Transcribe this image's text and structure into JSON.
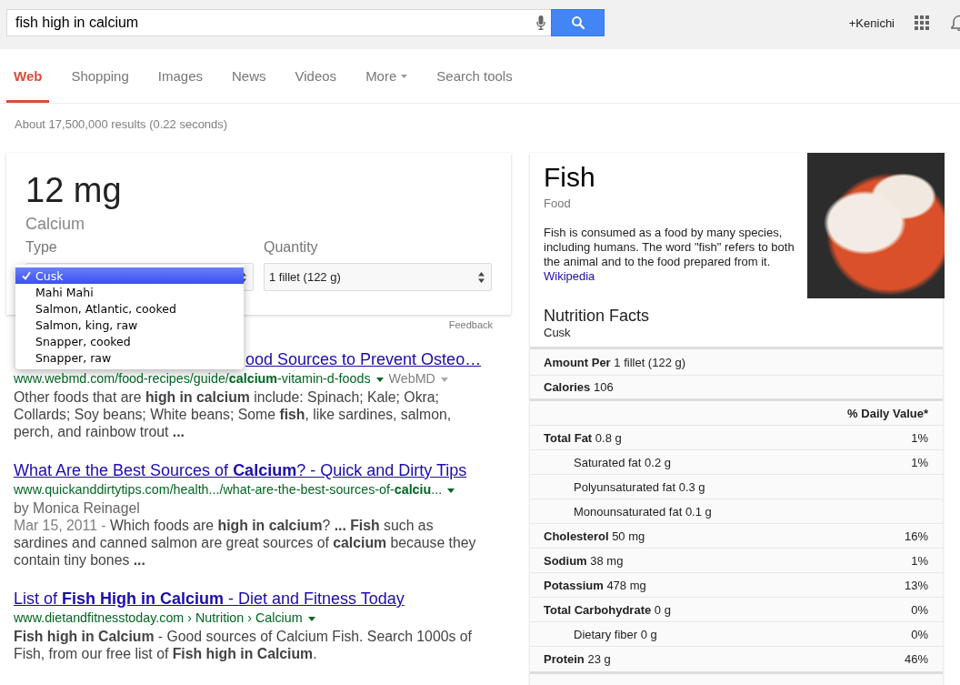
{
  "search": {
    "value": "fish high in calcium"
  },
  "account": {
    "name": "+Kenichi"
  },
  "tabs": [
    {
      "label": "Web",
      "selected": true,
      "kind": "plain"
    },
    {
      "label": "Shopping",
      "selected": false,
      "kind": "plain"
    },
    {
      "label": "Images",
      "selected": false,
      "kind": "plain"
    },
    {
      "label": "News",
      "selected": false,
      "kind": "plain"
    },
    {
      "label": "Videos",
      "selected": false,
      "kind": "plain"
    },
    {
      "label": "More",
      "selected": false,
      "kind": "dropdown"
    },
    {
      "label": "Search tools",
      "selected": false,
      "kind": "plain"
    }
  ],
  "result_stats": "About 17,500,000 results (0.22 seconds)",
  "answer_card": {
    "value": "12 mg",
    "nutrient": "Calcium",
    "type_select": {
      "label": "Type",
      "expanded": true,
      "options": [
        {
          "label": "Cusk",
          "selected": true
        },
        {
          "label": "Mahi Mahi",
          "selected": false
        },
        {
          "label": "Salmon, Atlantic, cooked",
          "selected": false
        },
        {
          "label": "Salmon, king, raw",
          "selected": false
        },
        {
          "label": "Snapper, cooked",
          "selected": false
        },
        {
          "label": "Snapper, raw",
          "selected": false
        }
      ]
    },
    "quantity_select": {
      "label": "Quantity",
      "value": "1 fillet (122 g)"
    },
    "feedback": "Feedback"
  },
  "results": [
    {
      "title": "ood Sources to Prevent Osteo…",
      "url": "www.webmd.com/food-recipes/guide/**calcium**-vitamin-d-foods",
      "source": "WebMD",
      "snippet": "Other foods that are **high in calcium** include: Spinach; Kale; Okra; Collards; Soy beans; White beans; Some **fish**, like sardines, salmon, perch, and rainbow trout  **...**"
    },
    {
      "title": "What Are the Best Sources of **Calcium**? - Quick and Dirty Tips",
      "url": "www.quickanddirtytips.com/health.../what-are-the-best-sources-of-**calciu**...",
      "byline": "by Monica Reinagel",
      "date": "Mar 15, 2011 -",
      "snippet": "Which foods are **high in calcium**? **...** **Fish** such as sardines and canned salmon are great sources of **calcium** because they contain tiny bones  **...**"
    },
    {
      "title": "List of **Fish High in Calcium** - Diet and Fitness Today",
      "url": "www.dietandfitnesstoday.com › Nutrition › Calcium",
      "snippet": "**Fish high in Calcium** - Good sources of Calcium Fish. Search 1000s of Fish, from our free list of **Fish high in Calcium**."
    }
  ],
  "knowledge_panel": {
    "title": "Fish",
    "type": "Food",
    "description": "Fish is consumed as a food by many species, including humans. The word \"fish\" refers to both the animal and to the food prepared from it.",
    "source_link": "Wikipedia",
    "nutrition": {
      "title": "Nutrition Facts",
      "subtitle": "Cusk",
      "serving": {
        "label": "Amount Per",
        "value": "1 fillet (122 g)"
      },
      "calories": {
        "label": "Calories",
        "value": "106"
      },
      "daily_value_heading": "% Daily Value*",
      "nutrients": [
        {
          "name": "Total Fat",
          "amount": "0.8 g",
          "daily_value": "1%",
          "children": [
            {
              "name": "Saturated fat",
              "amount": "0.2 g",
              "daily_value": "1%"
            },
            {
              "name": "Polyunsaturated fat",
              "amount": "0.3 g"
            },
            {
              "name": "Monounsaturated fat",
              "amount": "0.1 g"
            }
          ]
        },
        {
          "name": "Cholesterol",
          "amount": "50 mg",
          "daily_value": "16%"
        },
        {
          "name": "Sodium",
          "amount": "38 mg",
          "daily_value": "1%"
        },
        {
          "name": "Potassium",
          "amount": "478 mg",
          "daily_value": "13%"
        },
        {
          "name": "Total Carbohydrate",
          "amount": "0 g",
          "daily_value": "0%",
          "children": [
            {
              "name": "Dietary fiber",
              "amount": "0 g",
              "daily_value": "0%"
            }
          ]
        },
        {
          "name": "Protein",
          "amount": "23 g",
          "daily_value": "46%"
        }
      ]
    }
  }
}
